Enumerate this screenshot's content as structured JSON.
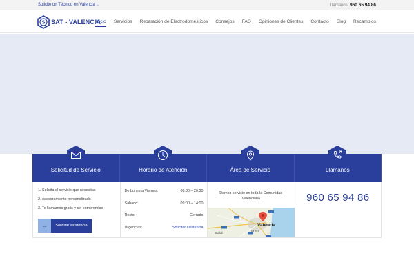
{
  "topbar": {
    "request_link": "Solicite un Técnico en Valencia →",
    "call_label": "Llámanos:",
    "call_number": "960 65 94 86"
  },
  "brand": {
    "name": "SAT - VALENCIA",
    "badge_letter": "S",
    "accent": "#2a3f9c"
  },
  "nav": {
    "items": [
      {
        "label": "Inicio",
        "active": true
      },
      {
        "label": "Servicios"
      },
      {
        "label": "Reparación de Electrodomésticos"
      },
      {
        "label": "Consejos"
      },
      {
        "label": "FAQ"
      },
      {
        "label": "Opiniones de Clientes"
      },
      {
        "label": "Contacto"
      },
      {
        "label": "Blog"
      },
      {
        "label": "Recambios"
      }
    ]
  },
  "cards": {
    "service": {
      "title": "Solicitud de Servicio",
      "icon": "envelope-icon",
      "steps": [
        "1.  Solicita el servicio que necesitas",
        "2.  Asesoramiento personalizado",
        "3.  Te llamamos gratis y sin compromiso"
      ],
      "cta_label": "Solicitar asistencia",
      "cta_icon": "arrow-right-icon"
    },
    "hours": {
      "title": "Horario de Atención",
      "icon": "clock-icon",
      "rows": [
        {
          "day": "De Lunes a Viernes:",
          "time": "08:30 – 20:30"
        },
        {
          "day": "Sábado:",
          "time": "09:00 – 14:00"
        },
        {
          "day": "Resto:",
          "time": "Cerrado"
        },
        {
          "day": "Urgencias:",
          "time": "Solicitar asistencia"
        }
      ]
    },
    "area": {
      "title": "Área de Servicio",
      "icon": "map-pin-icon",
      "text": "Damos servicio en toda la Comunidad Valenciana",
      "map_labels": [
        "Valencia",
        "Buñol",
        "Torrent"
      ]
    },
    "call": {
      "title": "Llámanos",
      "icon": "phone-icon",
      "number": "960 65 94 86"
    }
  }
}
